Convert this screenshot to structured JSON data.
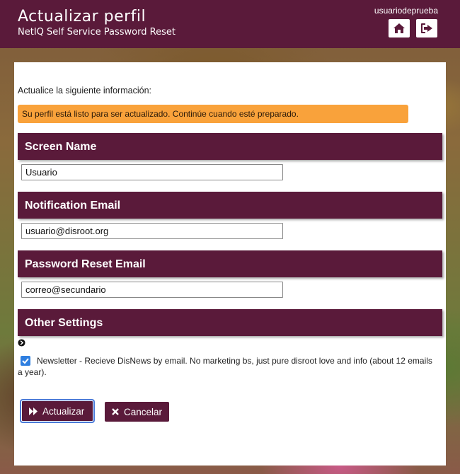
{
  "header": {
    "title": "Actualizar perfil",
    "subtitle": "NetIQ Self Service Password Reset",
    "username": "usuariodeprueba",
    "home_icon": "home-icon",
    "logout_icon": "logout-icon"
  },
  "form": {
    "intro": "Actualice la siguiente información:",
    "notice": "Su perfil está listo para ser actualizado. Continúe cuando esté preparado.",
    "sections": {
      "screen_name": {
        "title": "Screen Name",
        "value": "Usuario"
      },
      "notification_email": {
        "title": "Notification Email",
        "value": "usuario@disroot.org"
      },
      "reset_email": {
        "title": "Password Reset Email",
        "value": "correo@secundario"
      },
      "other_settings": {
        "title": "Other Settings"
      }
    },
    "newsletter": {
      "checked": true,
      "label": "Newsletter - Recieve DisNews by email. No marketing bs, just pure disroot love and info (about 12 emails a year)."
    }
  },
  "buttons": {
    "update": "Actualizar",
    "cancel": "Cancelar"
  },
  "colors": {
    "brand": "#5a1a3a",
    "notice": "#f9a23b",
    "focus": "#4a7ad8"
  }
}
